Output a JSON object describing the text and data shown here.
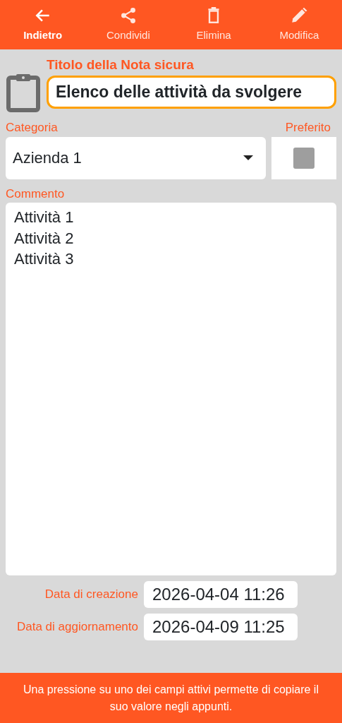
{
  "toolbar": [
    {
      "kind": "back",
      "label": "Indietro",
      "selected": true
    },
    {
      "kind": "share",
      "label": "Condividi",
      "selected": false
    },
    {
      "kind": "delete",
      "label": "Elimina",
      "selected": false
    },
    {
      "kind": "edit",
      "label": "Modifica",
      "selected": false
    }
  ],
  "title": {
    "label": "Titolo della Nota sicura",
    "value": "Elenco delle attività da svolgere"
  },
  "category": {
    "label": "Categoria",
    "value": "Azienda 1"
  },
  "favorite": {
    "label": "Preferito",
    "checked": false
  },
  "comment": {
    "label": "Commento",
    "lines": [
      "Attività 1",
      "Attività 2",
      "Attività 3"
    ]
  },
  "dates": [
    {
      "label": "Data di creazione",
      "value": "2026-04-04 11:26"
    },
    {
      "label": "Data di aggiornamento",
      "value": "2026-04-09 11:25"
    }
  ],
  "footer": "Una pressione su uno dei campi attivi permette di copiare il suo valore negli appunti."
}
